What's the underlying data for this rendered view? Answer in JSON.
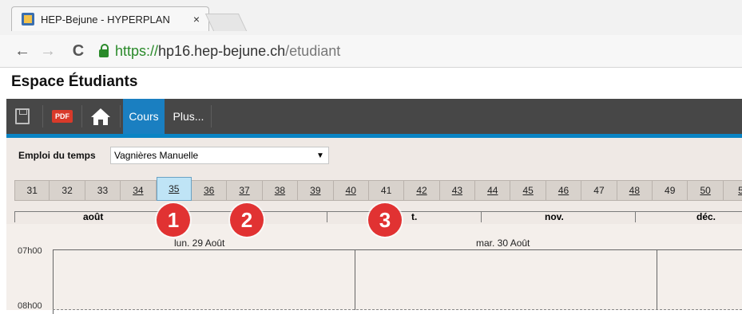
{
  "browser": {
    "tab_title": "HEP-Bejune - HYPERPLAN",
    "tab_close": "×",
    "url_scheme": "https://",
    "url_host": "hp16.hep-bejune.ch",
    "url_path": "/etudiant"
  },
  "page": {
    "title": "Espace Étudiants"
  },
  "toolbar": {
    "pdf_label": "PDF",
    "cours_label": "Cours",
    "plus_label": "Plus..."
  },
  "schedule": {
    "label": "Emploi du temps",
    "selected_student": "Vagnières Manuelle",
    "weeks": [
      {
        "n": "31",
        "link": false
      },
      {
        "n": "32",
        "link": false
      },
      {
        "n": "33",
        "link": false
      },
      {
        "n": "34",
        "link": true
      },
      {
        "n": "35",
        "link": true,
        "active": true
      },
      {
        "n": "36",
        "link": true
      },
      {
        "n": "37",
        "link": true
      },
      {
        "n": "38",
        "link": true
      },
      {
        "n": "39",
        "link": true
      },
      {
        "n": "40",
        "link": true
      },
      {
        "n": "41",
        "link": false
      },
      {
        "n": "42",
        "link": true
      },
      {
        "n": "43",
        "link": true
      },
      {
        "n": "44",
        "link": true
      },
      {
        "n": "45",
        "link": true
      },
      {
        "n": "46",
        "link": true
      },
      {
        "n": "47",
        "link": false
      },
      {
        "n": "48",
        "link": true
      },
      {
        "n": "49",
        "link": false
      },
      {
        "n": "50",
        "link": true
      },
      {
        "n": "5",
        "link": true
      }
    ],
    "months": [
      "août",
      "t.",
      "nov.",
      "déc."
    ],
    "day_headers": [
      "lun. 29 Août",
      "mar. 30 Août"
    ],
    "times": [
      "07h00",
      "08h00"
    ]
  },
  "annotations": [
    "1",
    "2",
    "3"
  ],
  "colors": {
    "accent": "#1a7fc1",
    "badge": "#e13232",
    "url_green": "#2a8a2a"
  }
}
